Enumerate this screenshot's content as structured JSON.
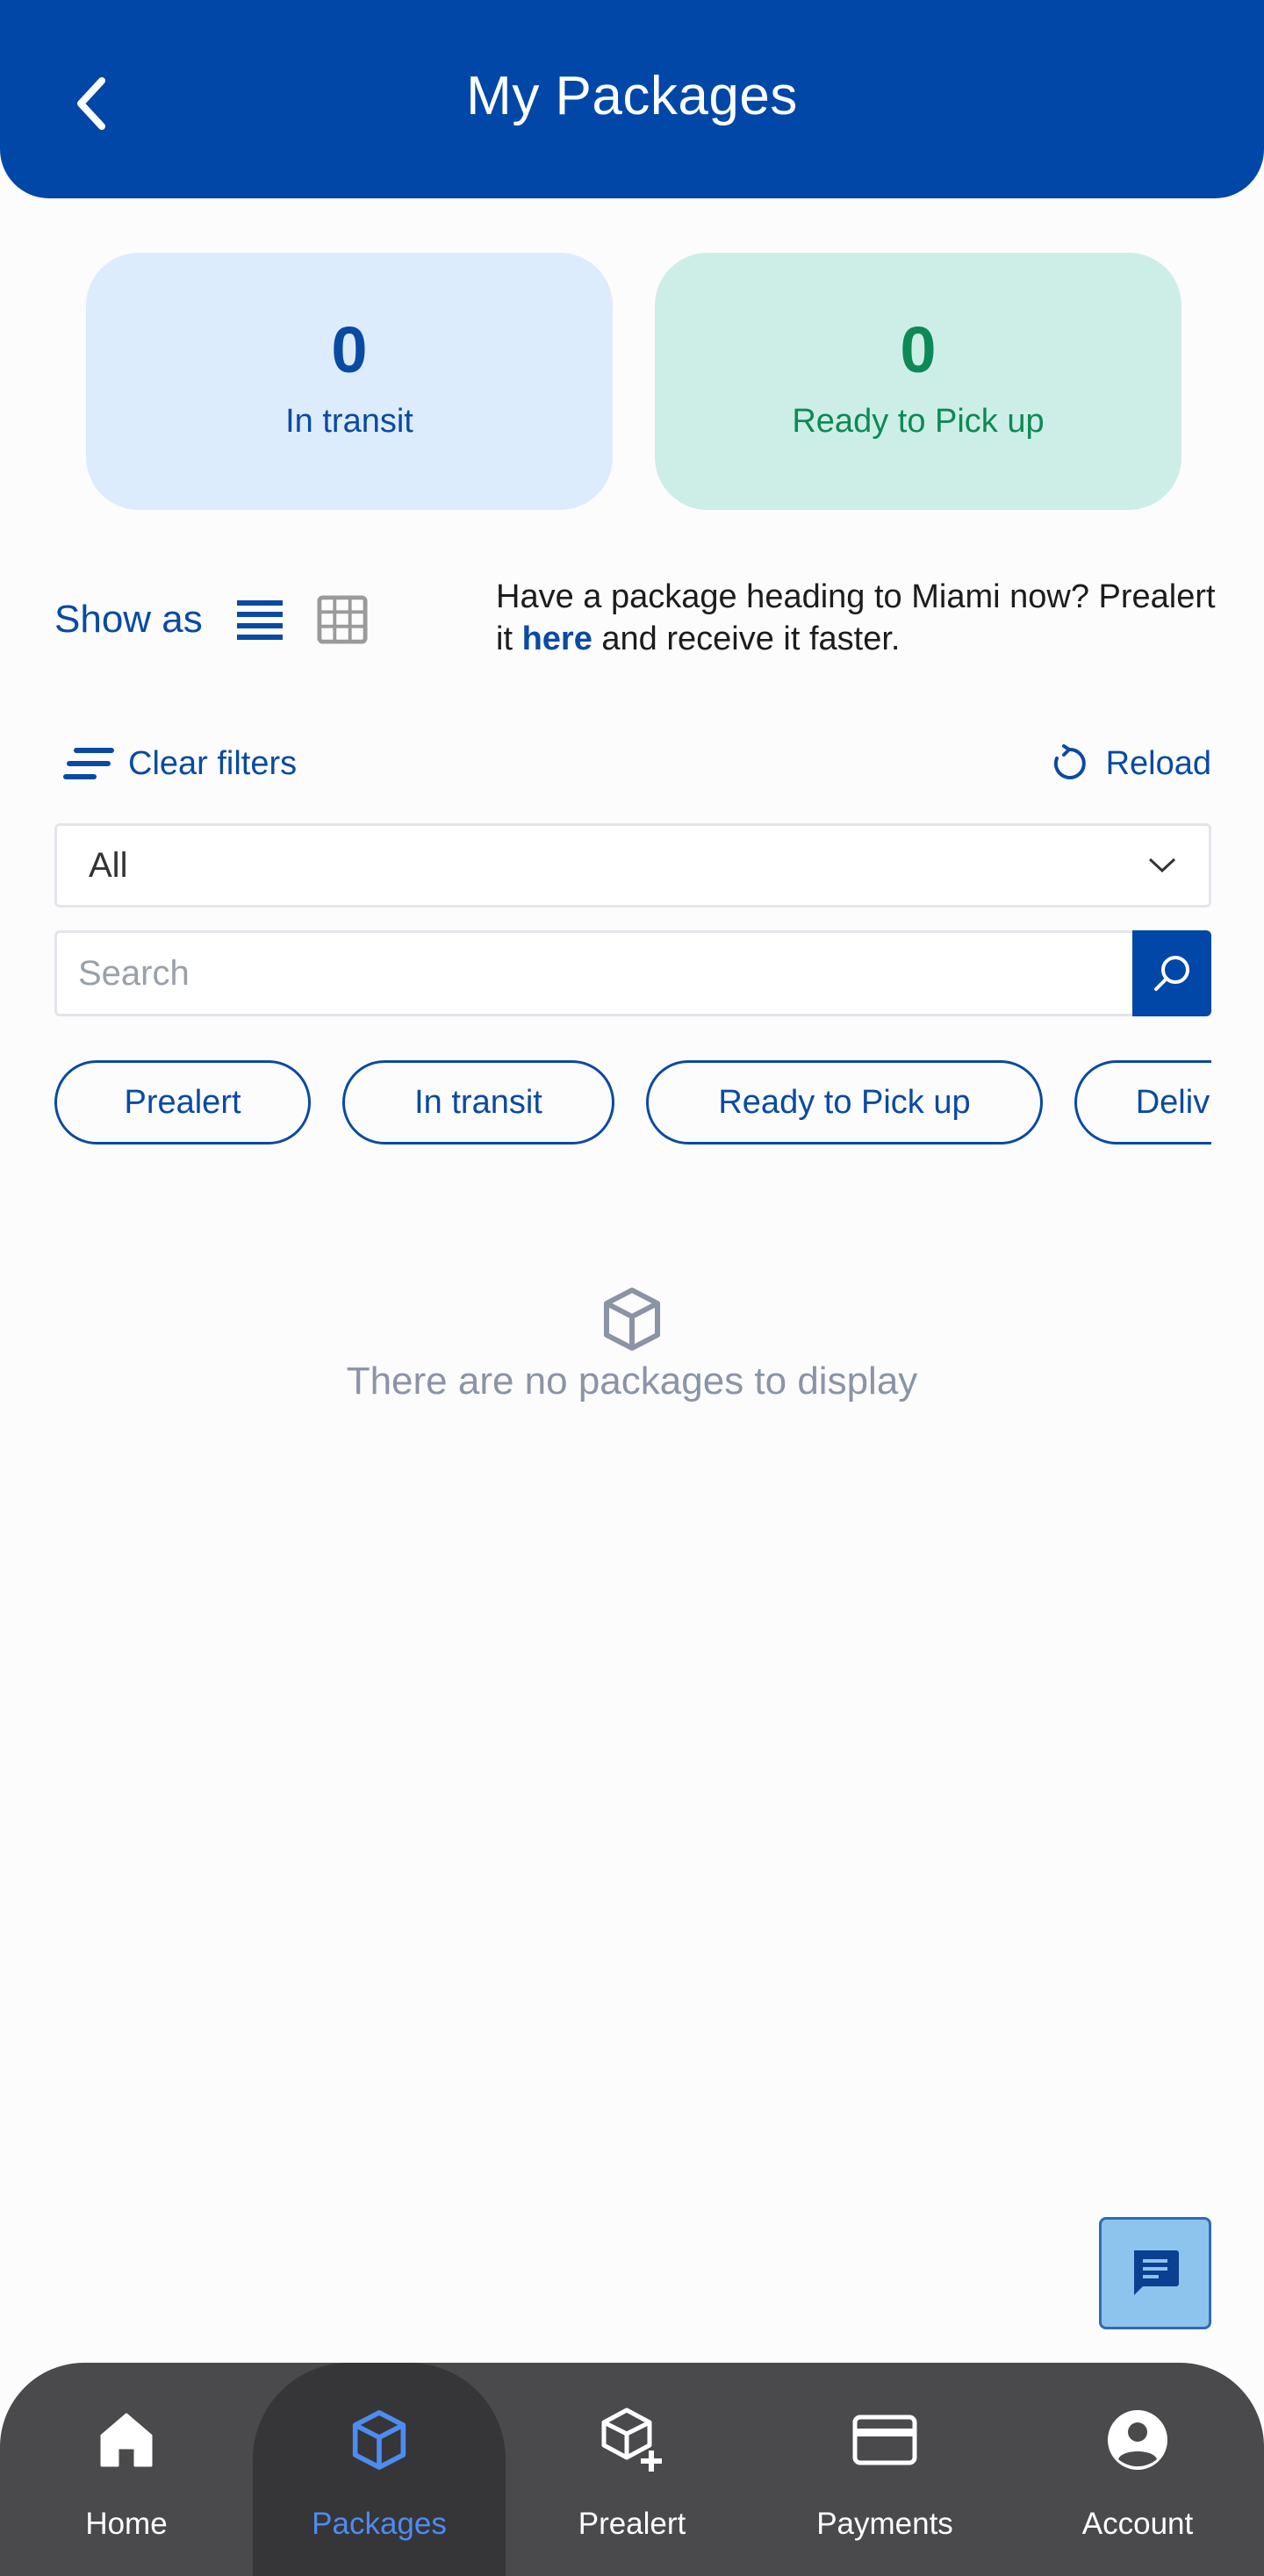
{
  "header": {
    "title": "My Packages"
  },
  "stats": {
    "in_transit": {
      "count": "0",
      "label": "In transit"
    },
    "ready": {
      "count": "0",
      "label": "Ready to Pick up"
    }
  },
  "view": {
    "show_as_label": "Show as",
    "modes": [
      "list-view-icon",
      "grid-view-icon"
    ],
    "selected": "list"
  },
  "prealert_note": {
    "text_before": "Have a package heading to Miami now? Prealert it ",
    "link": "here",
    "text_after": " and receive it faster."
  },
  "filters": {
    "clear_label": "Clear filters",
    "reload_label": "Reload",
    "select_value": "All",
    "search_placeholder": "Search",
    "chips": [
      {
        "label": "Prealert"
      },
      {
        "label": "In transit"
      },
      {
        "label": "Ready to Pick up"
      },
      {
        "label": "Delivered"
      }
    ]
  },
  "empty_state": {
    "message": "There are no packages to display"
  },
  "nav": {
    "items": [
      {
        "label": "Home",
        "icon": "home-icon"
      },
      {
        "label": "Packages",
        "icon": "package-icon",
        "active": true
      },
      {
        "label": "Prealert",
        "icon": "package-add-icon"
      },
      {
        "label": "Payments",
        "icon": "card-icon"
      },
      {
        "label": "Account",
        "icon": "account-icon"
      }
    ]
  },
  "colors": {
    "primary": "#0047a8",
    "accent_green": "#0c8a56",
    "nav_bg": "#4a494c",
    "nav_active": "#4d8cf0"
  }
}
